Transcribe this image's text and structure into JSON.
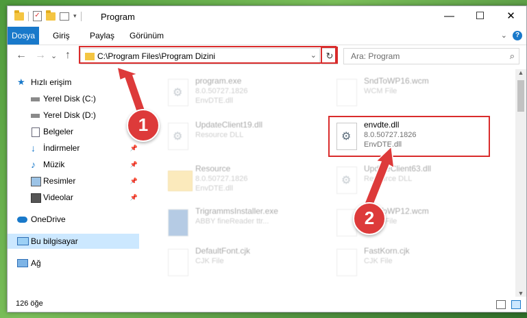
{
  "window": {
    "title": "Program",
    "minimize": "—",
    "maximize": "☐",
    "close": "✕"
  },
  "ribbon": {
    "tabs": [
      "Dosya",
      "Giriş",
      "Paylaş",
      "Görünüm"
    ],
    "help": "?",
    "expand": "⌄"
  },
  "navigation": {
    "back": "←",
    "forward": "→",
    "recent": "⌄",
    "up": "↑",
    "address": "C:\\Program Files\\Program Dizini",
    "address_dropdown": "⌄",
    "refresh": "↻",
    "search_placeholder": "Ara: Program",
    "search_icon": "⌕"
  },
  "sidebar": {
    "items": [
      {
        "label": "Hızlı erişim",
        "icon": "star-icon"
      },
      {
        "label": "Yerel Disk (C:)",
        "icon": "drive-icon"
      },
      {
        "label": "Yerel Disk (D:)",
        "icon": "drive-icon"
      },
      {
        "label": "Belgeler",
        "icon": "document-icon"
      },
      {
        "label": "İndirmeler",
        "icon": "download-icon"
      },
      {
        "label": "Müzik",
        "icon": "music-icon"
      },
      {
        "label": "Resimler",
        "icon": "pictures-icon"
      },
      {
        "label": "Videolar",
        "icon": "video-icon"
      },
      {
        "label": "OneDrive",
        "icon": "cloud-icon"
      },
      {
        "label": "Bu bilgisayar",
        "icon": "computer-icon"
      },
      {
        "label": "Ağ",
        "icon": "network-icon"
      }
    ],
    "pin": "📌"
  },
  "files": [
    {
      "name": "program.exe",
      "line1": "8.0.50727.1826",
      "line2": "EnvDTE.dll"
    },
    {
      "name": "SndToWP16.wcm",
      "line1": "WCM File",
      "line2": ""
    },
    {
      "name": "UpdateClient19.dll",
      "line1": "Resource DLL",
      "line2": ""
    },
    {
      "name": "envdte.dll",
      "line1": "8.0.50727.1826",
      "line2": "EnvDTE.dll"
    },
    {
      "name": "Resource",
      "line1": "8.0.50727.1826",
      "line2": "EnvDTE.dll"
    },
    {
      "name": "UpdateClient63.dll",
      "line1": "Resource DLL",
      "line2": ""
    },
    {
      "name": "TrigrammsInstaller.exe",
      "line1": "ABBY fineReader ttr...",
      "line2": ""
    },
    {
      "name": "SndToWP12.wcm",
      "line1": "WCM File",
      "line2": ""
    },
    {
      "name": "DefaultFont.cjk",
      "line1": "CJK File",
      "line2": ""
    },
    {
      "name": "FastKorn.cjk",
      "line1": "CJK File",
      "line2": ""
    }
  ],
  "annotations": {
    "step1": "1",
    "step2": "2"
  },
  "status": {
    "count": "126 öğe"
  },
  "colors": {
    "accent": "#1979ca",
    "highlight": "#d92b2b",
    "selected": "#cce8ff"
  }
}
